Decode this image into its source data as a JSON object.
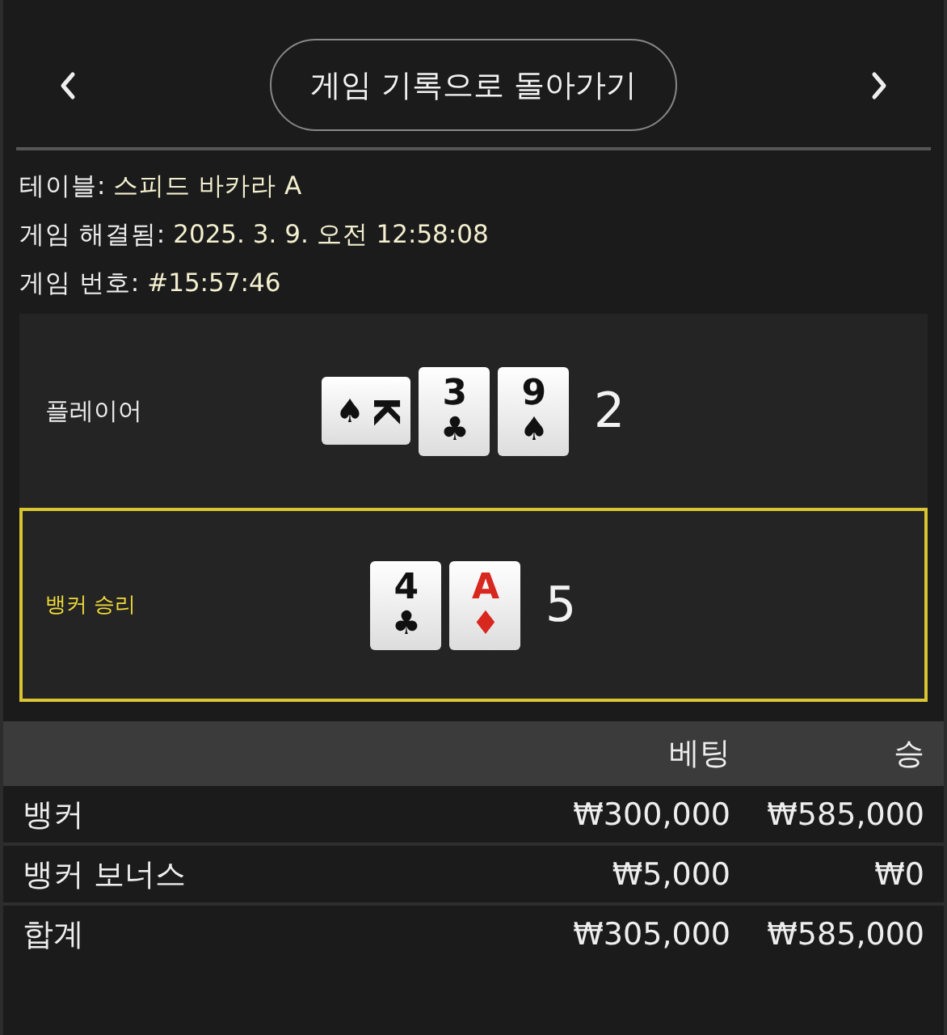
{
  "nav": {
    "back_label": "게임 기록으로 돌아가기"
  },
  "info": [
    {
      "label": "테이블:",
      "value": "스피드 바카라 A"
    },
    {
      "label": "게임 해결됨:",
      "value": "2025. 3. 9. 오전 12:58:08"
    },
    {
      "label": "게임 번호:",
      "value": "#15:57:46"
    }
  ],
  "hands": [
    {
      "label": "플레이어",
      "winner": false,
      "score": "2",
      "cards": [
        {
          "rank": "K",
          "suit": "♠",
          "color": "#111111",
          "rotated": true
        },
        {
          "rank": "3",
          "suit": "♣",
          "color": "#111111",
          "rotated": false
        },
        {
          "rank": "9",
          "suit": "♠",
          "color": "#111111",
          "rotated": false
        }
      ]
    },
    {
      "label": "뱅커 승리",
      "winner": true,
      "score": "5",
      "cards": [
        {
          "rank": "4",
          "suit": "♣",
          "color": "#111111",
          "rotated": false
        },
        {
          "rank": "A",
          "suit": "♦",
          "color": "#d8271f",
          "rotated": false
        }
      ]
    }
  ],
  "table": {
    "columns": [
      "베팅",
      "승"
    ],
    "rows": [
      {
        "name": "뱅커",
        "bet": "₩300,000",
        "win": "₩585,000"
      },
      {
        "name": "뱅커 보너스",
        "bet": "₩5,000",
        "win": "₩0"
      }
    ],
    "total": {
      "name": "합계",
      "bet": "₩305,000",
      "win": "₩585,000"
    }
  }
}
